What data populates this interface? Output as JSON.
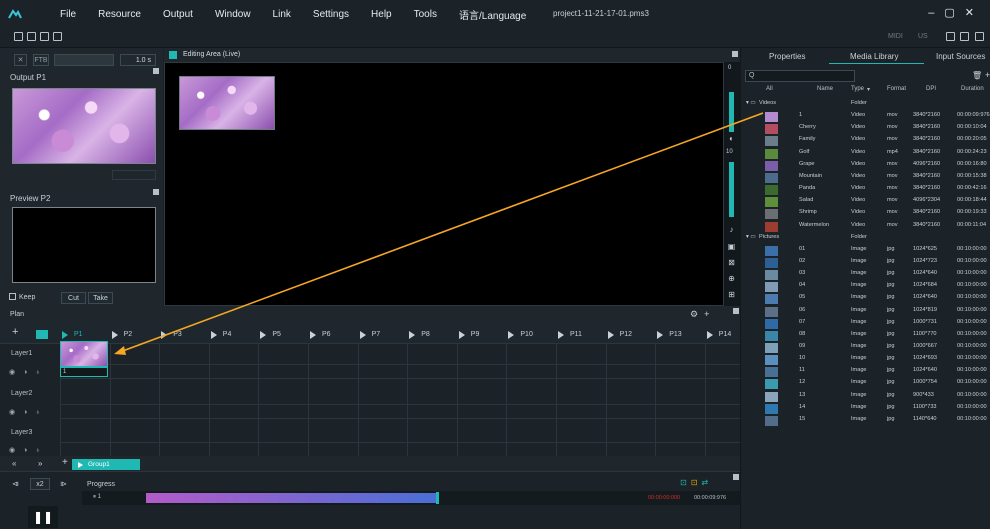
{
  "menu": {
    "items": [
      "File",
      "Resource",
      "Output",
      "Window",
      "Link",
      "Settings",
      "Help",
      "Tools",
      "语言/Language"
    ],
    "project_title": "project1-11-21-17-01.pms3"
  },
  "toolbar": {
    "right_labels": [
      "MIDI",
      "US"
    ]
  },
  "left": {
    "time_value": "1.0 s",
    "output_label": "Output  P1",
    "preview_label": "Preview  P2",
    "keep_label": "Keep",
    "cut_label": "Cut",
    "take_label": "Take"
  },
  "editing": {
    "title": "Editing Area (Live)",
    "scale_top": "0",
    "scale_mid": "10"
  },
  "plan": {
    "title": "Plan",
    "programs": [
      "P1",
      "P2",
      "P3",
      "P4",
      "P5",
      "P6",
      "P7",
      "P8",
      "P9",
      "P10",
      "P11",
      "P12",
      "P13",
      "P14"
    ],
    "layers": [
      "Layer1",
      "Layer2",
      "Layer3"
    ],
    "clip_index": "1"
  },
  "group": {
    "label": "Group1"
  },
  "progress": {
    "speed": "x2",
    "label": "Progress",
    "item": "1",
    "time_red": "00:00:00:000",
    "time_end": "00:00:09:976",
    "fraction": 0.49
  },
  "right": {
    "tabs": [
      "Properties",
      "Media Library",
      "Input Sources"
    ],
    "search_placeholder": "Q",
    "columns": [
      "All",
      "Name",
      "Type",
      "Format",
      "DPI",
      "Duration"
    ],
    "folders": [
      {
        "name": "Videos",
        "type": "Folder",
        "items": [
          {
            "name": "1",
            "type": "Video",
            "format": "mov",
            "dpi": "3840*2160",
            "duration": "00:00:09:976"
          },
          {
            "name": "Cherry",
            "type": "Video",
            "format": "mov",
            "dpi": "3840*2160",
            "duration": "00:00:10:04"
          },
          {
            "name": "Family",
            "type": "Video",
            "format": "mov",
            "dpi": "3840*2160",
            "duration": "00:00:20:05"
          },
          {
            "name": "Golf",
            "type": "Video",
            "format": "mp4",
            "dpi": "3840*2160",
            "duration": "00:00:24:23"
          },
          {
            "name": "Grape",
            "type": "Video",
            "format": "mov",
            "dpi": "4096*2160",
            "duration": "00:00:16:80"
          },
          {
            "name": "Mountain",
            "type": "Video",
            "format": "mov",
            "dpi": "3840*2160",
            "duration": "00:00:15:38"
          },
          {
            "name": "Panda",
            "type": "Video",
            "format": "mov",
            "dpi": "3840*2160",
            "duration": "00:00:42:16"
          },
          {
            "name": "Salad",
            "type": "Video",
            "format": "mov",
            "dpi": "4096*2304",
            "duration": "00:00:18:44"
          },
          {
            "name": "Shrimp",
            "type": "Video",
            "format": "mov",
            "dpi": "3840*2160",
            "duration": "00:00:19:33"
          },
          {
            "name": "Watermelon",
            "type": "Video",
            "format": "mov",
            "dpi": "3840*2160",
            "duration": "00:00:11:04"
          }
        ]
      },
      {
        "name": "Pictures",
        "type": "Folder",
        "items": [
          {
            "name": "01",
            "type": "Image",
            "format": "jpg",
            "dpi": "1024*625",
            "duration": "00:10:00:00"
          },
          {
            "name": "02",
            "type": "Image",
            "format": "jpg",
            "dpi": "1024*723",
            "duration": "00:10:00:00"
          },
          {
            "name": "03",
            "type": "Image",
            "format": "jpg",
            "dpi": "1024*640",
            "duration": "00:10:00:00"
          },
          {
            "name": "04",
            "type": "Image",
            "format": "jpg",
            "dpi": "1024*684",
            "duration": "00:10:00:00"
          },
          {
            "name": "05",
            "type": "Image",
            "format": "jpg",
            "dpi": "1024*640",
            "duration": "00:10:00:00"
          },
          {
            "name": "06",
            "type": "Image",
            "format": "jpg",
            "dpi": "1024*819",
            "duration": "00:10:00:00"
          },
          {
            "name": "07",
            "type": "Image",
            "format": "jpg",
            "dpi": "1000*731",
            "duration": "00:10:00:00"
          },
          {
            "name": "08",
            "type": "Image",
            "format": "jpg",
            "dpi": "1100*770",
            "duration": "00:10:00:00"
          },
          {
            "name": "09",
            "type": "Image",
            "format": "jpg",
            "dpi": "1000*667",
            "duration": "00:10:00:00"
          },
          {
            "name": "10",
            "type": "Image",
            "format": "jpg",
            "dpi": "1024*693",
            "duration": "00:10:00:00"
          },
          {
            "name": "11",
            "type": "Image",
            "format": "jpg",
            "dpi": "1024*640",
            "duration": "00:10:00:00"
          },
          {
            "name": "12",
            "type": "Image",
            "format": "jpg",
            "dpi": "1000*754",
            "duration": "00:10:00:00"
          },
          {
            "name": "13",
            "type": "Image",
            "format": "jpg",
            "dpi": "900*433",
            "duration": "00:10:00:00"
          },
          {
            "name": "14",
            "type": "Image",
            "format": "jpg",
            "dpi": "1100*733",
            "duration": "00:10:00:00"
          },
          {
            "name": "15",
            "type": "Image",
            "format": "jpg",
            "dpi": "1140*640",
            "duration": "00:10:00:00"
          }
        ]
      }
    ]
  },
  "colors": {
    "accent": "#1fb8b2",
    "arrow": "#f5a623",
    "progress_start": "#b35bc9",
    "progress_end": "#4a6fd6",
    "time_red": "#d22c2c"
  }
}
